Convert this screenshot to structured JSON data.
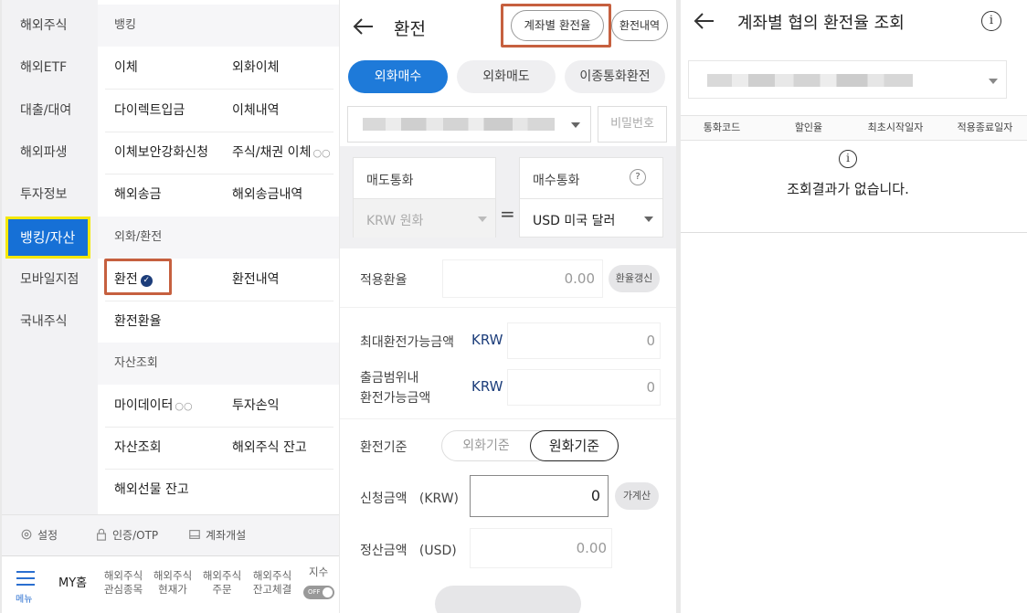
{
  "menu": {
    "left_categories": [
      "해외주식",
      "해외ETF",
      "대출/대여",
      "해외파생",
      "투자정보",
      "뱅킹/자산",
      "모바일지점",
      "국내주식"
    ],
    "active_category": "뱅킹/자산",
    "banking_header": "뱅킹",
    "banking_items": [
      "이체",
      "외화이체",
      "다이렉트입금",
      "이체내역",
      "이체보안강화신청",
      "주식/채권 이체",
      "해외송금",
      "해외송금내역"
    ],
    "fx_header": "외화/환전",
    "fx_items": [
      "환전",
      "환전내역",
      "환전환율"
    ],
    "asset_header": "자산조회",
    "asset_items": [
      "마이데이터",
      "투자손익",
      "자산조회",
      "해외주식 잔고",
      "해외선물 잔고"
    ],
    "link_mark": "○○",
    "tools": [
      "설정",
      "인증/OTP",
      "계좌개설"
    ]
  },
  "tabbar": {
    "menu_label": "메뉴",
    "my_home": "MY홈",
    "items": [
      [
        "해외주식",
        "관심종목"
      ],
      [
        "해외주식",
        "현재가"
      ],
      [
        "해외주식",
        "주문"
      ],
      [
        "해외주식",
        "잔고체결"
      ]
    ],
    "index_label": "지수",
    "toggle_label": "OFF"
  },
  "exchange": {
    "title": "환전",
    "rate_by_account_btn": "계좌별 환전율",
    "history_btn": "환전내역",
    "tabs": [
      "외화매수",
      "외화매도",
      "이종통화환전"
    ],
    "password_placeholder": "비밀번호",
    "sell_currency_label": "매도통화",
    "buy_currency_label": "매수통화",
    "help_mark": "?",
    "sell_currency": "KRW 원화",
    "equals": "=",
    "buy_currency": "USD 미국 달러",
    "applied_rate_label": "적용환율",
    "applied_rate_value": "0.00",
    "refresh_rate_btn": "환율갱신",
    "max_amount_label": "최대환전가능금액",
    "max_amount_currency": "KRW",
    "max_amount_value": "0",
    "withdraw_label_1": "출금범위내",
    "withdraw_label_2": "환전가능금액",
    "withdraw_currency": "KRW",
    "withdraw_value": "0",
    "basis_label": "환전기준",
    "basis_options": [
      "외화기준",
      "원화기준"
    ],
    "basis_selected": "원화기준",
    "request_label": "신청금액",
    "request_unit": "(KRW)",
    "request_value": "0",
    "calc_btn": "가계산",
    "settle_label": "정산금액",
    "settle_unit": "(USD)",
    "settle_value": "0.00"
  },
  "rate_inquiry": {
    "title": "계좌별 협의 환전율 조회",
    "info_mark": "i",
    "columns": [
      "통화코드",
      "할인율",
      "최초시작일자",
      "적용종료일자"
    ],
    "empty_message": "조회결과가 없습니다."
  },
  "colors": {
    "accent_blue": "#1e7ad9",
    "highlight_box": "#c6603f",
    "active_border": "#f4e800",
    "active_bg": "#1670d6"
  }
}
